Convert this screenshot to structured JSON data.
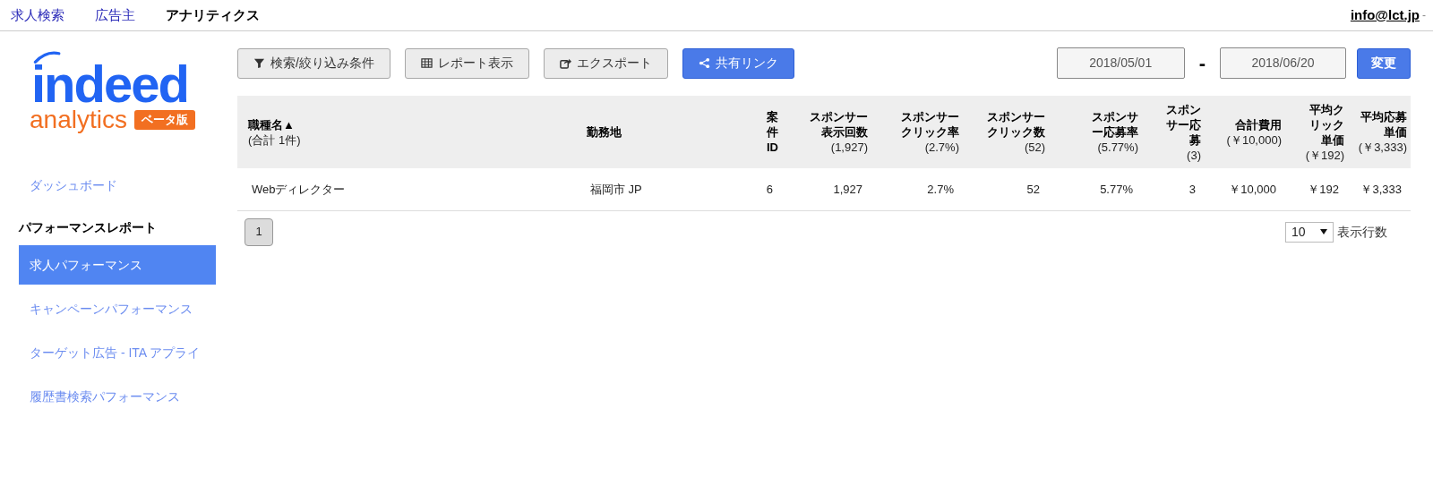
{
  "top_nav": [
    {
      "label": "求人検索",
      "selected": false
    },
    {
      "label": "広告主",
      "selected": false
    },
    {
      "label": "アナリティクス",
      "selected": true
    }
  ],
  "account": {
    "email": "info@lct.jp",
    "caret": "-"
  },
  "logo": {
    "brand": "indeed",
    "product": "analytics",
    "badge": "ベータ版"
  },
  "sidebar": {
    "items": [
      {
        "kind": "link",
        "label": "ダッシュボード",
        "selected": false
      },
      {
        "kind": "header",
        "label": "パフォーマンスレポート"
      },
      {
        "kind": "link",
        "label": "求人パフォーマンス",
        "selected": true
      },
      {
        "kind": "link",
        "label": "キャンペーンパフォーマンス",
        "selected": false
      },
      {
        "kind": "link",
        "label": "ターゲット広告 - ITA アプライ",
        "selected": false
      },
      {
        "kind": "link",
        "label": "履歴書検索パフォーマンス",
        "selected": false
      }
    ]
  },
  "toolbar": [
    {
      "label": "検索/絞り込み条件",
      "primary": false
    },
    {
      "label": "レポート表示",
      "primary": false
    },
    {
      "label": "エクスポート",
      "primary": false
    },
    {
      "label": "共有リンク",
      "primary": true
    }
  ],
  "date_range": {
    "start": "2018/05/01",
    "separator": "-",
    "end": "2018/06/20",
    "apply": "変更"
  },
  "table": {
    "columns": [
      {
        "lines": [
          "職種名▲"
        ],
        "total": "(合計 1件)"
      },
      {
        "lines": [
          "勤務地"
        ]
      },
      {
        "lines": [
          "案",
          "件",
          "ID"
        ]
      },
      {
        "lines": [
          "スポンサー",
          "表示回数"
        ],
        "total": "(1,927)"
      },
      {
        "lines": [
          "スポンサー",
          "クリック率"
        ],
        "total": "(2.7%)"
      },
      {
        "lines": [
          "スポンサー",
          "クリック数"
        ],
        "total": "(52)"
      },
      {
        "lines": [
          "スポンサ",
          "ー応募率"
        ],
        "total": "(5.77%)"
      },
      {
        "lines": [
          "スポン",
          "サー応",
          "募"
        ],
        "total": "(3)"
      },
      {
        "lines": [
          "合計費用"
        ],
        "total": "(￥10,000)"
      },
      {
        "lines": [
          "平均ク",
          "リック",
          "単価"
        ],
        "total": "(￥192)"
      },
      {
        "lines": [
          "平均応募",
          "単価"
        ],
        "total": "(￥3,333)"
      }
    ],
    "rows": [
      [
        "Webディレクター",
        "福岡市 JP",
        "6",
        "1,927",
        "2.7%",
        "52",
        "5.77%",
        "3",
        "￥10,000",
        "￥192",
        "￥3,333"
      ]
    ]
  },
  "pagination": {
    "pages": [
      {
        "label": "1",
        "selected": true
      }
    ]
  },
  "rows_per_page": {
    "value": "10",
    "label": "表示行数"
  }
}
